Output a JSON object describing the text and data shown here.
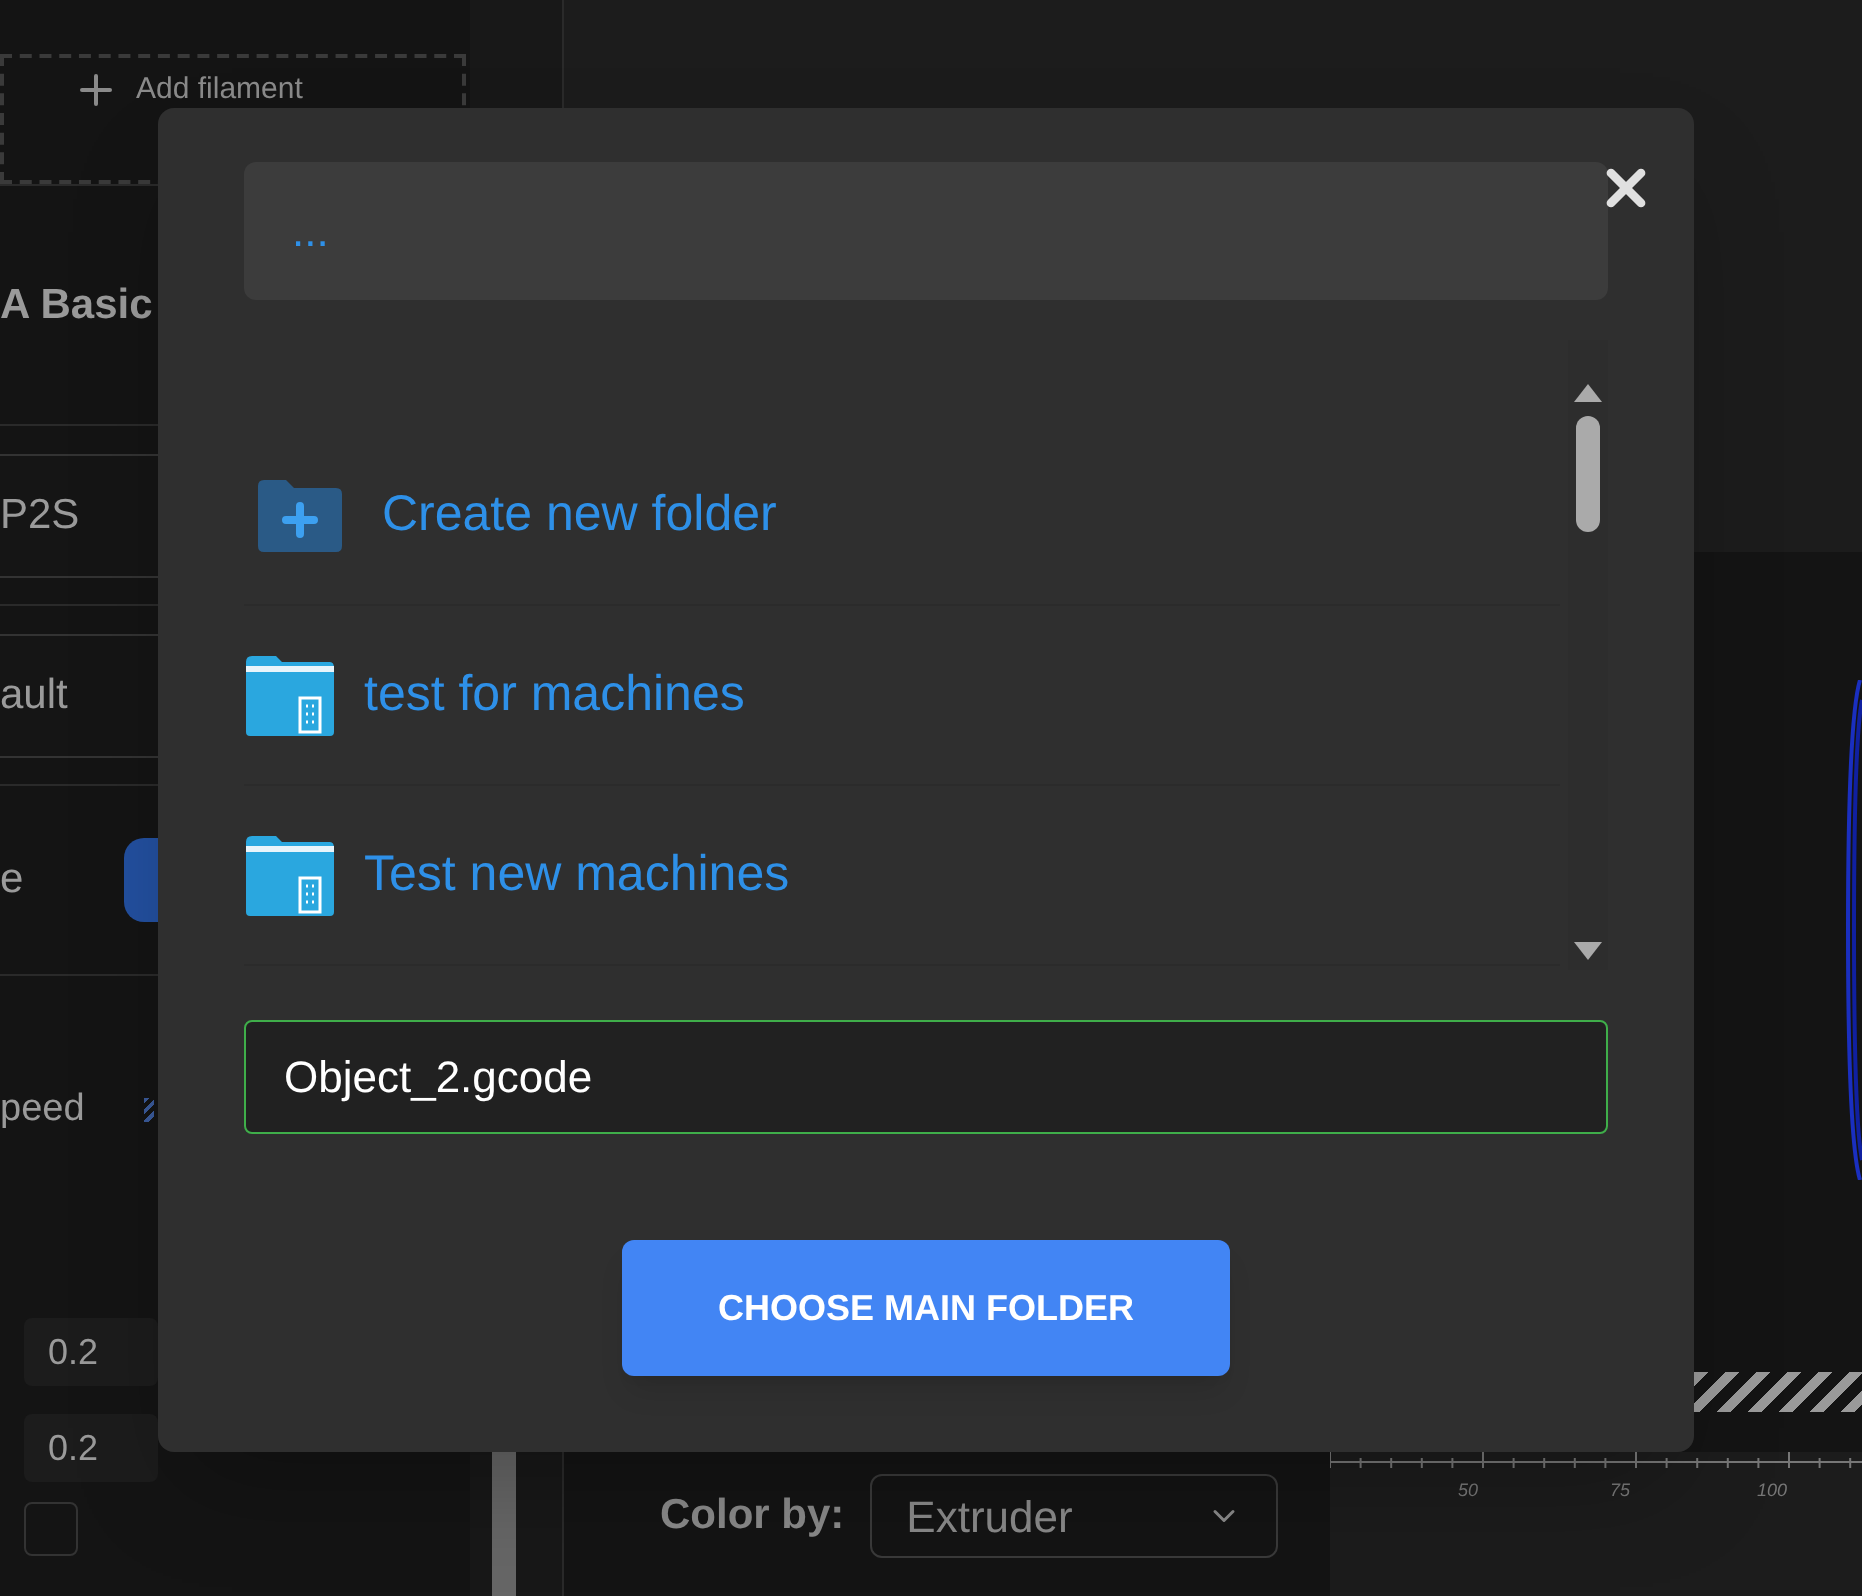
{
  "sidebar": {
    "add_button": "Add filament",
    "rows": [
      {
        "kind": "title",
        "text": "A Basic"
      },
      {
        "kind": "select",
        "text": "P2S"
      },
      {
        "kind": "select",
        "text": "ault"
      },
      {
        "kind": "toggle",
        "text": "e"
      },
      {
        "kind": "mode",
        "text": "peed"
      }
    ],
    "values": [
      "0.2",
      "0.2"
    ],
    "checkbox": {
      "checked": false
    }
  },
  "viewer": {
    "color_by": {
      "label": "Color by:",
      "value": "Extruder"
    },
    "ruler_labels": [
      "50",
      "75",
      "100"
    ]
  },
  "dialog": {
    "path": "...",
    "items": [
      {
        "kind": "new",
        "label": "Create new folder"
      },
      {
        "kind": "folder",
        "label": "test for machines"
      },
      {
        "kind": "folder",
        "label": "Test new machines"
      }
    ],
    "filename": "Object_2.gcode",
    "button": "CHOOSE MAIN FOLDER"
  }
}
